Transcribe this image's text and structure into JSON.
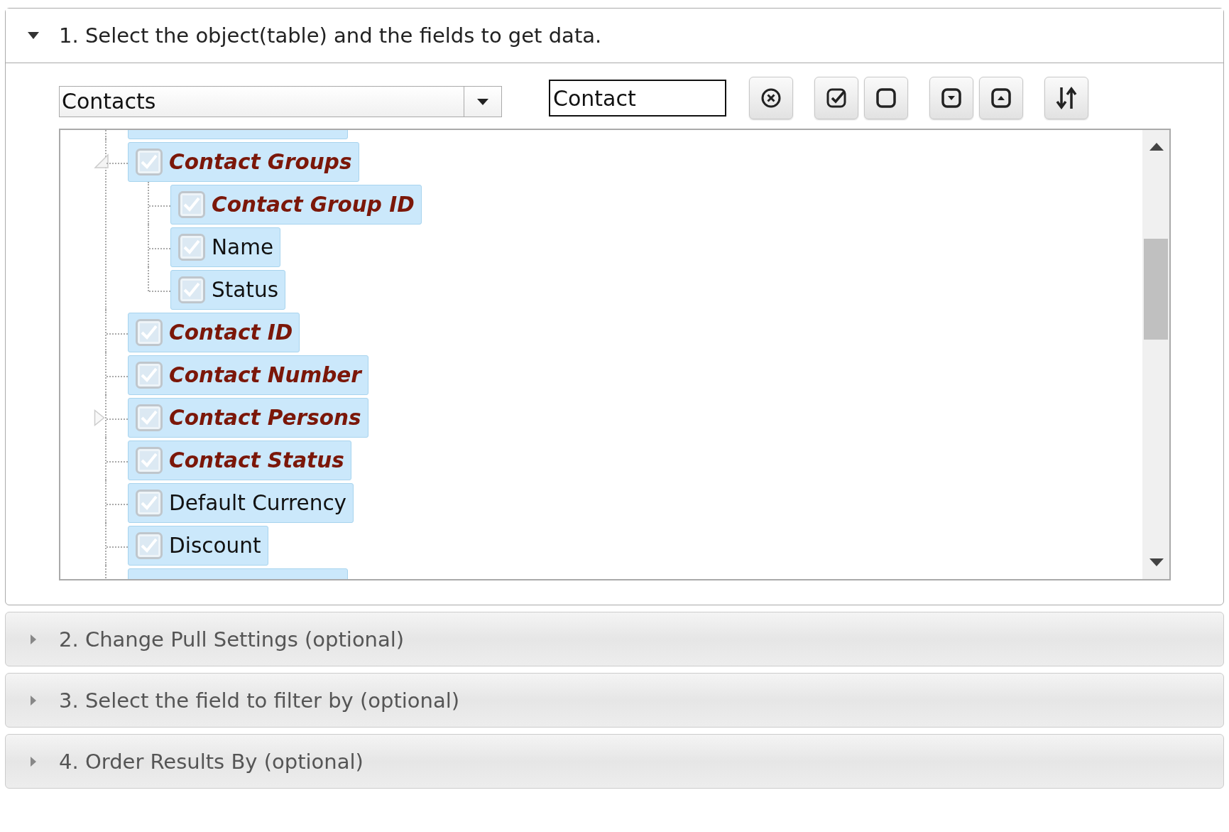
{
  "sections": [
    {
      "title": "1. Select the object(table) and the fields to get data.",
      "expanded": true
    },
    {
      "title": "2. Change Pull Settings (optional)",
      "expanded": false
    },
    {
      "title": "3. Select the field to filter by (optional)",
      "expanded": false
    },
    {
      "title": "4. Order Results By (optional)",
      "expanded": false
    }
  ],
  "object_select": {
    "value": "Contacts"
  },
  "search": {
    "value": "Contact"
  },
  "tree": {
    "nodes": [
      {
        "label": "Contact Groups",
        "emphasized": true,
        "checked": true,
        "selected": true,
        "expanded": true,
        "children": [
          {
            "label": "Contact Group ID",
            "emphasized": true,
            "checked": true,
            "selected": true
          },
          {
            "label": "Name",
            "emphasized": false,
            "checked": true,
            "selected": true
          },
          {
            "label": "Status",
            "emphasized": false,
            "checked": true,
            "selected": true
          }
        ]
      },
      {
        "label": "Contact ID",
        "emphasized": true,
        "checked": true,
        "selected": true
      },
      {
        "label": "Contact Number",
        "emphasized": true,
        "checked": true,
        "selected": true
      },
      {
        "label": "Contact Persons",
        "emphasized": true,
        "checked": true,
        "selected": true,
        "expanded": false
      },
      {
        "label": "Contact Status",
        "emphasized": true,
        "checked": true,
        "selected": true
      },
      {
        "label": "Default Currency",
        "emphasized": false,
        "checked": true,
        "selected": true
      },
      {
        "label": "Discount",
        "emphasized": false,
        "checked": true,
        "selected": true
      }
    ]
  }
}
